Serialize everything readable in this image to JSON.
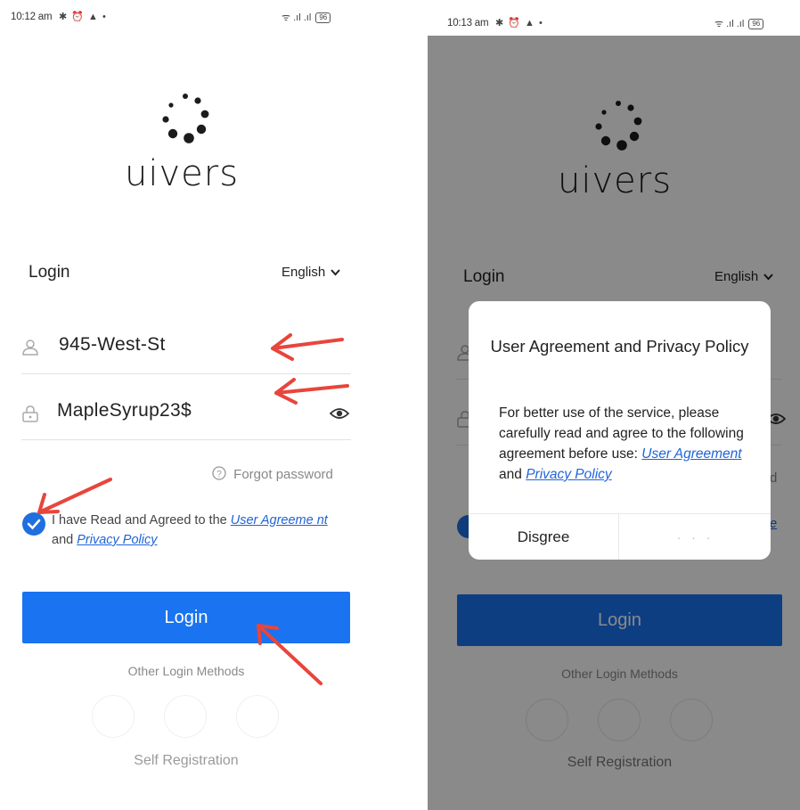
{
  "left_screen": {
    "status": {
      "time": "10:12 am",
      "icons": "✱ ⏰ ▲ •",
      "signal": "ᯤ .ıl .ıl",
      "battery": "96"
    },
    "logo": {
      "text": "uivers"
    },
    "login_heading": "Login",
    "language": "English",
    "username": {
      "value": "945-West-St"
    },
    "password": {
      "value": "MapleSyrup23$"
    },
    "forgot_password": "Forgot password",
    "agreement": {
      "prefix": "I have Read and Agreed to the",
      "user_agreement_link": "User Agreeme nt",
      "and": "and",
      "privacy_policy_link": "Privacy Policy"
    },
    "login_button": "Login",
    "other_login_methods": "Other Login Methods",
    "self_registration": "Self Registration"
  },
  "right_screen": {
    "status": {
      "time": "10:13 am",
      "icons": "✱ ⏰ ▲ •",
      "signal": "ᯤ .ıl .ıl",
      "battery": "96"
    },
    "logo": {
      "text": "uivers"
    },
    "login_heading": "Login",
    "language": "English",
    "forgot_fragment": "d",
    "agreement_fragment": "e",
    "login_button": "Login",
    "other_login_methods": "Other Login Methods",
    "self_registration": "Self Registration",
    "dialog": {
      "title": "User Agreement and Privacy Policy",
      "body_prefix": "For better use of the service, please carefully read and agree to the following agreement before use:",
      "user_agreement_link": "User Agreement",
      "and": "and",
      "privacy_policy_link": "Privacy Policy",
      "disagree_button": "Disgree",
      "agree_button": "· · ·"
    }
  },
  "colors": {
    "primary": "#1a73f0",
    "link": "#1f64d8",
    "annotation_arrow": "#e8453c"
  }
}
